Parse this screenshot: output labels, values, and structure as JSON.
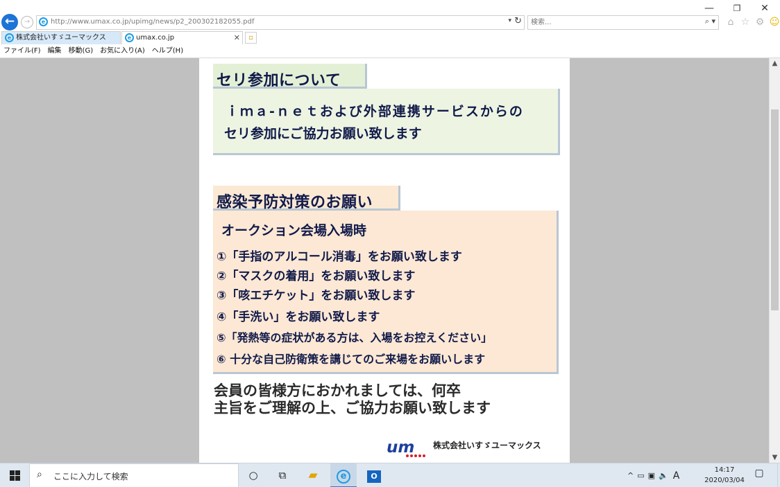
{
  "window": {
    "minimize_glyph": "—",
    "maximize_glyph": "❐",
    "close_glyph": "✕"
  },
  "navigation": {
    "back_glyph": "←",
    "forward_glyph": "→",
    "url": "http://www.umax.co.jp/upimg/news/p2_200302182055.pdf",
    "dropdown_glyph": "▾",
    "refresh_glyph": "↻"
  },
  "search": {
    "placeholder": "検索...",
    "button_glyph": "⌕ ▾"
  },
  "toolbar_icons": [
    {
      "name": "home-icon",
      "glyph": "⌂"
    },
    {
      "name": "favorites-star-icon",
      "glyph": "☆"
    },
    {
      "name": "settings-gear-icon",
      "glyph": "⚙"
    },
    {
      "name": "feedback-smiley-icon",
      "glyph": "☺"
    }
  ],
  "tabs": [
    {
      "label": "株式会社いすゞユーマックス",
      "active": true
    },
    {
      "label": "umax.co.jp",
      "active": false,
      "close_glyph": "✕"
    }
  ],
  "new_tab_glyph": "▫",
  "menu": [
    "ファイル(F)",
    "編集",
    "移動(G)",
    "お気に入り(A)",
    "ヘルプ(H)"
  ],
  "scrollbar": {
    "up_glyph": "▲",
    "down_glyph": "▼"
  },
  "document": {
    "section1": {
      "heading": "セリ参加について",
      "line1": "ｉｍａ-ｎｅｔおよび外部連携サービスからの",
      "line2": "セリ参加にご協力お願い致します"
    },
    "section2": {
      "heading": "感染予防対策のお願い",
      "subheading": "オークション会場入場時",
      "rules": [
        "①「手指のアルコール消毒」をお願い致します",
        "②「マスクの着用」をお願い致します",
        "③「咳エチケット」をお願い致します",
        "④「手洗い」をお願い致します",
        "⑤「発熱等の症状がある方は、入場をお控えください」",
        "⑥ 十分な自己防衛策を講じてのご来場をお願いします"
      ]
    },
    "closing": {
      "line1": "会員の皆様方におかれましては、何卒",
      "line2": "主旨をご理解の上、ご協力お願い致します"
    },
    "company_name": "株式会社いすゞユーマックス",
    "logo_text": "um"
  },
  "taskbar": {
    "search_placeholder": "ここに入力して検索",
    "cortana_glyph": "○",
    "taskview_glyph": "⧉",
    "explorer_glyph": "▰",
    "ie_glyph": "e",
    "outlook_label": "O",
    "tray": {
      "chevron_glyph": "^",
      "battery_glyph": "▭",
      "network_glyph": "▣",
      "volume_glyph": "🔈",
      "ime_label": "A"
    },
    "time": "14:17",
    "date": "2020/03/04",
    "notification_glyph": "▢"
  },
  "colors": {
    "ie_blue": "#1e73d6",
    "section1_bg": "#edf4e2",
    "section2_bg": "#fce8d4",
    "logo_blue": "#1d3f9e",
    "logo_red": "#d6202a"
  }
}
